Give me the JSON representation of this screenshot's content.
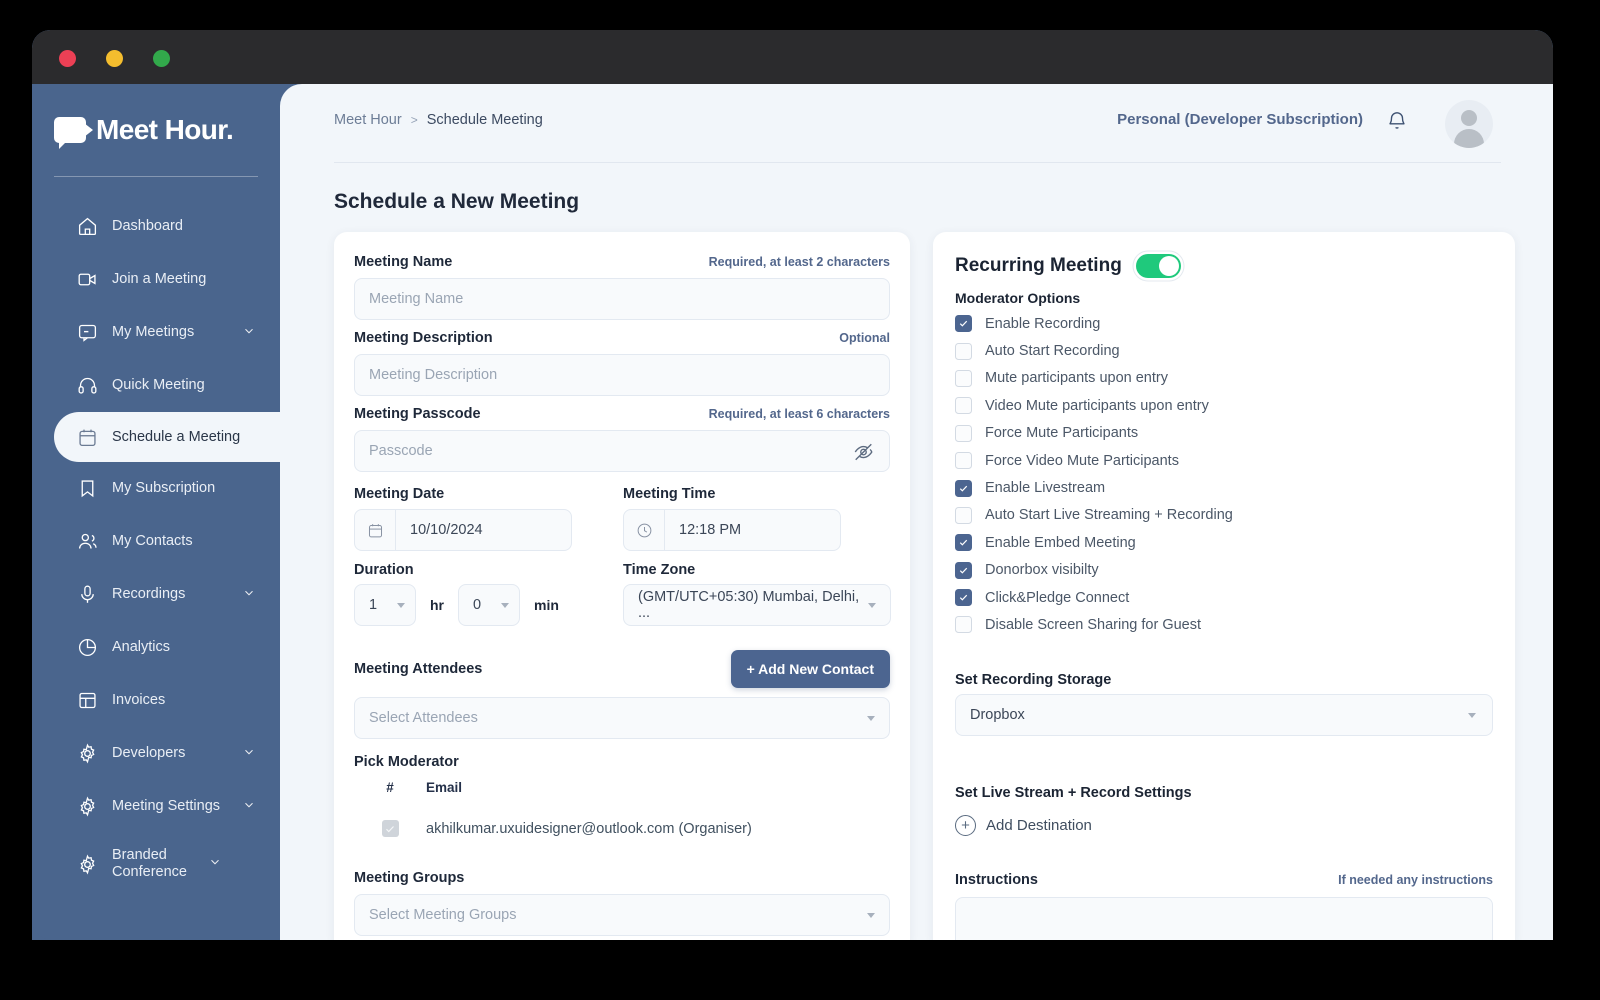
{
  "window": {
    "traffic_lights": [
      "close",
      "minimize",
      "maximize"
    ]
  },
  "brand": {
    "name": "Meet Hour."
  },
  "sidebar": {
    "items": [
      {
        "label": "Dashboard",
        "icon": "home-icon",
        "chevron": false,
        "active": false
      },
      {
        "label": "Join a Meeting",
        "icon": "video-icon",
        "chevron": false,
        "active": false
      },
      {
        "label": "My Meetings",
        "icon": "chat-icon",
        "chevron": true,
        "active": false
      },
      {
        "label": "Quick Meeting",
        "icon": "headset-icon",
        "chevron": false,
        "active": false
      },
      {
        "label": "Schedule a Meeting",
        "icon": "calendar-icon",
        "chevron": false,
        "active": true
      },
      {
        "label": "My Subscription",
        "icon": "bookmark-icon",
        "chevron": false,
        "active": false
      },
      {
        "label": "My Contacts",
        "icon": "people-icon",
        "chevron": false,
        "active": false
      },
      {
        "label": "Recordings",
        "icon": "microphone-icon",
        "chevron": true,
        "active": false
      },
      {
        "label": "Analytics",
        "icon": "pie-chart-icon",
        "chevron": false,
        "active": false
      },
      {
        "label": "Invoices",
        "icon": "layout-icon",
        "chevron": false,
        "active": false
      },
      {
        "label": "Developers",
        "icon": "gear-icon",
        "chevron": true,
        "active": false
      },
      {
        "label": "Meeting Settings",
        "icon": "gear-icon",
        "chevron": true,
        "active": false
      },
      {
        "label": "Branded Conference",
        "icon": "gear-icon",
        "chevron": true,
        "active": false
      }
    ]
  },
  "topbar": {
    "breadcrumb_root": "Meet Hour",
    "breadcrumb_separator": ">",
    "breadcrumb_current": "Schedule Meeting",
    "subscription": "Personal (Developer Subscription)",
    "bell_icon": "bell-icon",
    "avatar_icon": "user-avatar-icon"
  },
  "page": {
    "title": "Schedule a New Meeting"
  },
  "form": {
    "meeting_name": {
      "label": "Meeting Name",
      "hint": "Required, at least 2 characters",
      "placeholder": "Meeting Name",
      "value": ""
    },
    "meeting_description": {
      "label": "Meeting Description",
      "hint": "Optional",
      "placeholder": "Meeting Description",
      "value": ""
    },
    "meeting_passcode": {
      "label": "Meeting Passcode",
      "hint": "Required, at least 6 characters",
      "placeholder": "Passcode",
      "value": "",
      "toggle_icon": "eye-off-icon"
    },
    "meeting_date": {
      "label": "Meeting Date",
      "value": "10/10/2024",
      "icon": "calendar-icon"
    },
    "meeting_time": {
      "label": "Meeting Time",
      "value": "12:18 PM",
      "icon": "clock-icon"
    },
    "duration": {
      "label": "Duration",
      "hours_value": "1",
      "hours_unit": "hr",
      "minutes_value": "0",
      "minutes_unit": "min"
    },
    "time_zone": {
      "label": "Time Zone",
      "value": "(GMT/UTC+05:30) Mumbai, Delhi, ..."
    },
    "attendees": {
      "label": "Meeting Attendees",
      "add_button": "+ Add New Contact",
      "placeholder": "Select Attendees"
    },
    "pick_moderator": {
      "label": "Pick Moderator",
      "columns": [
        "#",
        "Email"
      ],
      "rows": [
        {
          "checked": true,
          "disabled": true,
          "email": "akhilkumar.uxuidesigner@outlook.com (Organiser)"
        }
      ]
    },
    "meeting_groups": {
      "label": "Meeting Groups",
      "placeholder": "Select Meeting Groups"
    }
  },
  "settings": {
    "recurring": {
      "label": "Recurring Meeting",
      "enabled": true
    },
    "moderator_options": {
      "label": "Moderator Options",
      "items": [
        {
          "label": "Enable Recording",
          "checked": true
        },
        {
          "label": "Auto Start Recording",
          "checked": false
        },
        {
          "label": "Mute participants upon entry",
          "checked": false
        },
        {
          "label": "Video Mute participants upon entry",
          "checked": false
        },
        {
          "label": "Force Mute Participants",
          "checked": false
        },
        {
          "label": "Force Video Mute Participants",
          "checked": false
        },
        {
          "label": "Enable Livestream",
          "checked": true
        },
        {
          "label": "Auto Start Live Streaming + Recording",
          "checked": false
        },
        {
          "label": "Enable Embed Meeting",
          "checked": true
        },
        {
          "label": "Donorbox visibilty",
          "checked": true
        },
        {
          "label": "Click&Pledge Connect",
          "checked": true
        },
        {
          "label": "Disable Screen Sharing for Guest",
          "checked": false
        }
      ]
    },
    "recording_storage": {
      "label": "Set Recording Storage",
      "value": "Dropbox"
    },
    "live_stream": {
      "label": "Set Live Stream + Record Settings",
      "add_destination": "Add Destination",
      "add_icon": "plus-circle-icon"
    },
    "instructions": {
      "label": "Instructions",
      "hint": "If needed any instructions",
      "value": ""
    }
  },
  "colors": {
    "sidebar": "#4a658d",
    "content_bg": "#f2f6fa",
    "accent": "#4c6590",
    "toggle_on": "#1fc97c",
    "titlebar": "#2b2b2d",
    "close": "#ec4055",
    "minimize": "#f4bd2e",
    "maximize": "#32a94b"
  }
}
